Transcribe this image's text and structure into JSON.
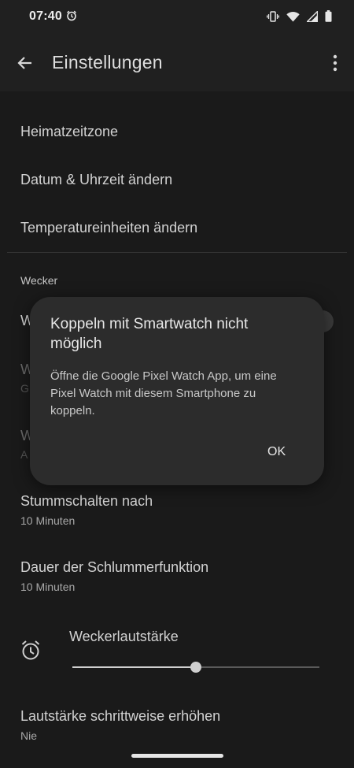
{
  "status_bar": {
    "time": "07:40",
    "icons": [
      "alarm-icon",
      "vibrate-icon",
      "wifi-icon",
      "signal-icon",
      "battery-icon"
    ]
  },
  "app_bar": {
    "title": "Einstellungen",
    "back_icon": "arrow-back-icon",
    "more_icon": "more-vert-icon"
  },
  "settings": {
    "items": [
      {
        "title": "Heimatzeitzone"
      },
      {
        "title": "Datum & Uhrzeit ändern"
      },
      {
        "title": "Temperatureinheiten ändern"
      }
    ],
    "section_header": "Wecker",
    "obscured_rows": [
      {
        "title_fragment": "W"
      },
      {
        "title_fragment": "W",
        "sub_fragment": "G"
      },
      {
        "title_fragment": "W",
        "sub_fragment": "A"
      }
    ],
    "mute_after": {
      "title": "Stummschalten nach",
      "value": "10 Minuten"
    },
    "snooze": {
      "title": "Dauer der Schlummerfunktion",
      "value": "10 Minuten"
    },
    "alarm_volume": {
      "label": "Weckerlautstärke",
      "level": 0.5
    },
    "gradual_volume": {
      "title": "Lautstärke schrittweise erhöhen",
      "value": "Nie"
    }
  },
  "dialog": {
    "title": "Koppeln mit Smartwatch nicht möglich",
    "body": "Öffne die Google Pixel Watch App, um eine Pixel Watch mit diesem Smartphone zu koppeln.",
    "ok_label": "OK"
  },
  "colors": {
    "background": "#1a1a1a",
    "dialog": "#2c2c2c",
    "text_primary": "#d2d2d2"
  }
}
